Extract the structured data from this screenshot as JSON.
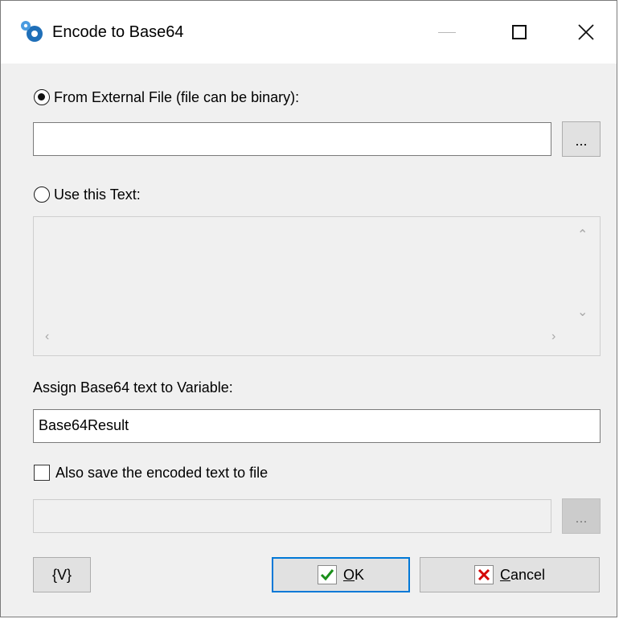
{
  "window": {
    "title": "Encode to Base64",
    "app_icon": "gear-cog-icon"
  },
  "source": {
    "from_file_label": "From External File (file can be binary):",
    "from_file_selected": true,
    "file_path_value": "",
    "browse_label": "...",
    "use_text_label": "Use this Text:",
    "use_text_selected": false,
    "text_value": ""
  },
  "variable": {
    "label": "Assign Base64 text to Variable:",
    "value": "Base64Result"
  },
  "save": {
    "checkbox_label": "Also save the encoded text to file",
    "checked": false,
    "file_path_value": "",
    "browse_label": "..."
  },
  "buttons": {
    "variables_label": "{V}",
    "ok_label": "OK",
    "ok_accel": "O",
    "ok_rest": "K",
    "cancel_label": "Cancel",
    "cancel_accel": "C",
    "cancel_rest": "ancel"
  },
  "colors": {
    "dialog_bg": "#f0f0f0",
    "accent_focus": "#0078d7",
    "ok_check": "#1a8f1a",
    "cancel_x": "#d40000"
  }
}
